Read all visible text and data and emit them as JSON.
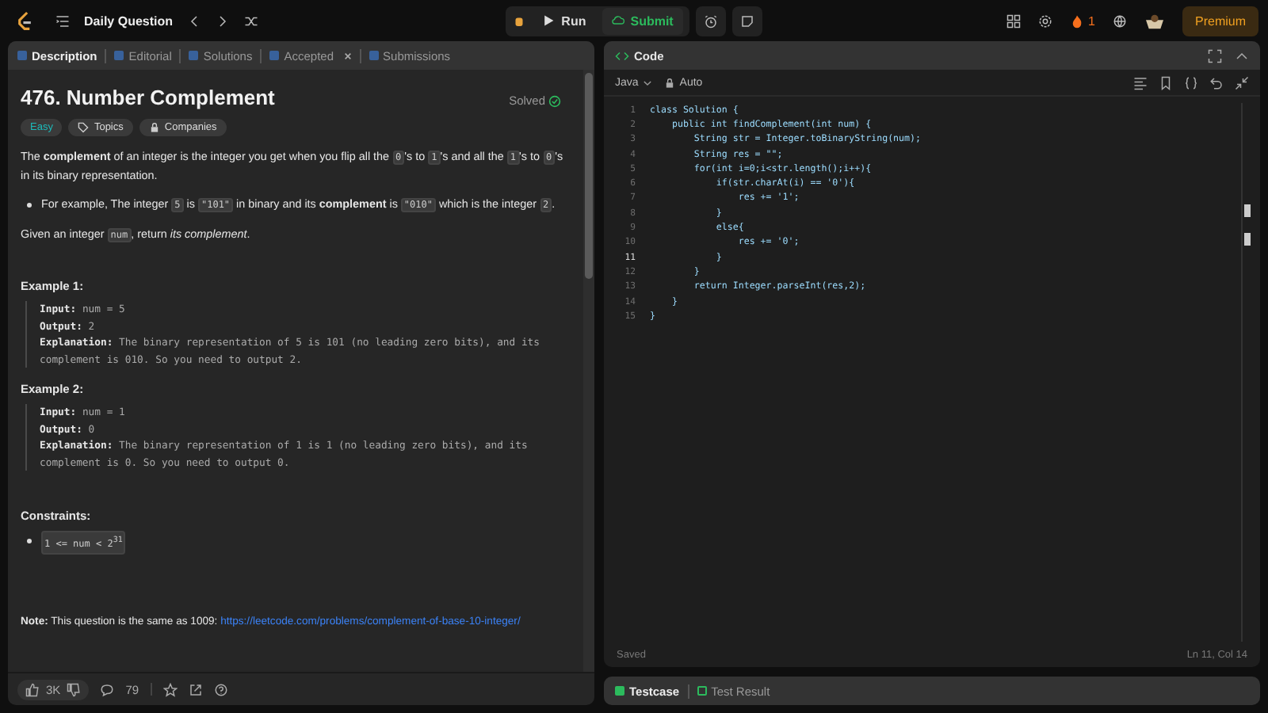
{
  "nav": {
    "title": "Daily Question",
    "run": "Run",
    "submit": "Submit",
    "streak": "1",
    "premium": "Premium"
  },
  "description": {
    "tabs": [
      {
        "label": "Description",
        "selected": true,
        "closable": false
      },
      {
        "label": "Editorial",
        "selected": false,
        "closable": false
      },
      {
        "label": "Solutions",
        "selected": false,
        "closable": false
      },
      {
        "label": "Accepted",
        "selected": false,
        "closable": true
      },
      {
        "label": "Submissions",
        "selected": false,
        "closable": false
      }
    ],
    "title": "476. Number Complement",
    "status": "Solved",
    "tags": [
      {
        "kind": "difficulty",
        "label": "Easy"
      },
      {
        "kind": "topics",
        "label": "Topics"
      },
      {
        "kind": "companies",
        "label": "Companies"
      }
    ],
    "intro": [
      {
        "kind": "text",
        "text": "The "
      },
      {
        "kind": "bold",
        "text": "complement"
      },
      {
        "kind": "text",
        "text": " of an integer is the integer you get when you flip all the "
      },
      {
        "kind": "code",
        "text": "0"
      },
      {
        "kind": "text",
        "text": "'s to "
      },
      {
        "kind": "code",
        "text": "1"
      },
      {
        "kind": "text",
        "text": "'s and all the "
      },
      {
        "kind": "code",
        "text": "1"
      },
      {
        "kind": "text",
        "text": "'s to "
      },
      {
        "kind": "code",
        "text": "0"
      },
      {
        "kind": "text",
        "text": "'s in its binary representation."
      }
    ],
    "bullets": [
      [
        {
          "kind": "text",
          "text": "For example, The integer "
        },
        {
          "kind": "code",
          "text": "5"
        },
        {
          "kind": "text",
          "text": " is "
        },
        {
          "kind": "code",
          "text": "\"101\""
        },
        {
          "kind": "text",
          "text": " in binary and its "
        },
        {
          "kind": "bold",
          "text": "complement"
        },
        {
          "kind": "text",
          "text": " is "
        },
        {
          "kind": "code",
          "text": "\"010\""
        },
        {
          "kind": "text",
          "text": " which is the integer "
        },
        {
          "kind": "code",
          "text": "2"
        },
        {
          "kind": "text",
          "text": "."
        }
      ]
    ],
    "task": [
      {
        "kind": "text",
        "text": "Given an integer "
      },
      {
        "kind": "code",
        "text": "num"
      },
      {
        "kind": "text",
        "text": ", return "
      },
      {
        "kind": "italic",
        "text": "its complement"
      },
      {
        "kind": "text",
        "text": "."
      }
    ],
    "examples": [
      {
        "title": "Example 1:",
        "lines": [
          {
            "label": "Input:",
            "value": "num = 5"
          },
          {
            "label": "Output:",
            "value": "2"
          },
          {
            "label": "Explanation:",
            "value": "The binary representation of 5 is 101 (no leading zero bits), and its complement is 010. So you need to output 2."
          }
        ]
      },
      {
        "title": "Example 2:",
        "lines": [
          {
            "label": "Input:",
            "value": "num = 1"
          },
          {
            "label": "Output:",
            "value": "0"
          },
          {
            "label": "Explanation:",
            "value": "The binary representation of 1 is 1 (no leading zero bits), and its complement is 0. So you need to output 0."
          }
        ]
      }
    ],
    "constraints_title": "Constraints:",
    "constraints": [
      "1 <= num < 2$^{31}$"
    ],
    "note": {
      "label": "Note:",
      "text": "This question is the same as 1009: ",
      "link": "https://leetcode.com/problems/complement-of-base-10-integer/"
    },
    "footer": {
      "likes": "3K",
      "comments": "79"
    }
  },
  "code": {
    "title": "Code",
    "language": "Java",
    "mode": "Auto",
    "lines": [
      {
        "number": "1",
        "text": "class Solution {",
        "current": false
      },
      {
        "number": "2",
        "text": "    public int findComplement(int num) {",
        "current": false
      },
      {
        "number": "3",
        "text": "        String str = Integer.toBinaryString(num);",
        "current": false
      },
      {
        "number": "4",
        "text": "        String res = \"\";",
        "current": false
      },
      {
        "number": "5",
        "text": "        for(int i=0;i<str.length();i++){",
        "current": false
      },
      {
        "number": "6",
        "text": "            if(str.charAt(i) == '0'){",
        "current": false
      },
      {
        "number": "7",
        "text": "                res += '1';",
        "current": false
      },
      {
        "number": "8",
        "text": "            }",
        "current": false
      },
      {
        "number": "9",
        "text": "            else{",
        "current": false
      },
      {
        "number": "10",
        "text": "                res += '0';",
        "current": false
      },
      {
        "number": "11",
        "text": "            }",
        "current": true
      },
      {
        "number": "12",
        "text": "        }",
        "current": false
      },
      {
        "number": "13",
        "text": "        return Integer.parseInt(res,2);",
        "current": false
      },
      {
        "number": "14",
        "text": "    }",
        "current": false
      },
      {
        "number": "15",
        "text": "}",
        "current": false
      }
    ],
    "status": "Saved",
    "cursor": "Ln 11, Col 14"
  },
  "bottom_tabs": [
    {
      "label": "Testcase",
      "selected": true
    },
    {
      "label": "Test Result",
      "selected": false
    }
  ]
}
